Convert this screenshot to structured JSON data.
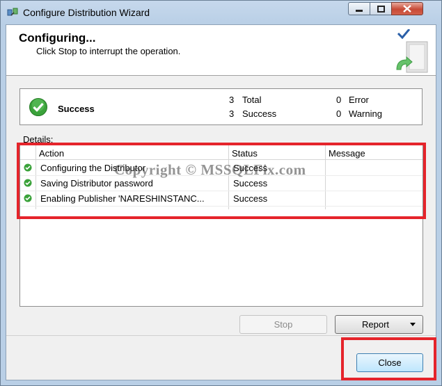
{
  "window": {
    "title": "Configure Distribution Wizard"
  },
  "header": {
    "title": "Configuring...",
    "subtitle": "Click Stop to interrupt the operation."
  },
  "summary": {
    "status": "Success",
    "total_count": "3",
    "total_label": "Total",
    "success_count": "3",
    "success_label": "Success",
    "error_count": "0",
    "error_label": "Error",
    "warning_count": "0",
    "warning_label": "Warning"
  },
  "details": {
    "label": "Details:",
    "columns": [
      "Action",
      "Status",
      "Message"
    ],
    "rows": [
      {
        "action": "Configuring the Distributor",
        "status": "Success",
        "message": ""
      },
      {
        "action": "Saving Distributor password",
        "status": "Success",
        "message": ""
      },
      {
        "action": "Enabling Publisher 'NARESHINSTANC...",
        "status": "Success",
        "message": ""
      }
    ]
  },
  "watermark": "Copyright © MSSQLFix.com",
  "buttons": {
    "stop": "Stop",
    "report": "Report",
    "close": "Close"
  },
  "colors": {
    "highlight": "#e5242b",
    "success_green": "#3aa23a"
  },
  "icons": [
    "wizard-app-icon",
    "minimize-icon",
    "maximize-icon",
    "close-icon",
    "server-icon",
    "success-check-icon",
    "row-success-icon",
    "dropdown-arrow-icon"
  ]
}
